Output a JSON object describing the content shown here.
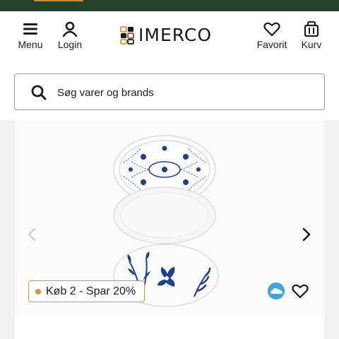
{
  "header": {
    "menu_label": "Menu",
    "login_label": "Login",
    "logo_text": "IMERCO",
    "favorites_label": "Favorit",
    "cart_label": "Kurv"
  },
  "search": {
    "placeholder": "Søg varer og brands"
  },
  "product": {
    "promo_badge": "Køb 2 - Spar 20%"
  },
  "colors": {
    "topbar": "#24432c",
    "promo_accent": "#e0913b",
    "plate_blue": "#1f3f8f"
  },
  "icons": {
    "menu": "hamburger-icon",
    "login": "user-icon",
    "favorite": "heart-icon",
    "cart": "basket-icon",
    "search": "search-icon"
  }
}
